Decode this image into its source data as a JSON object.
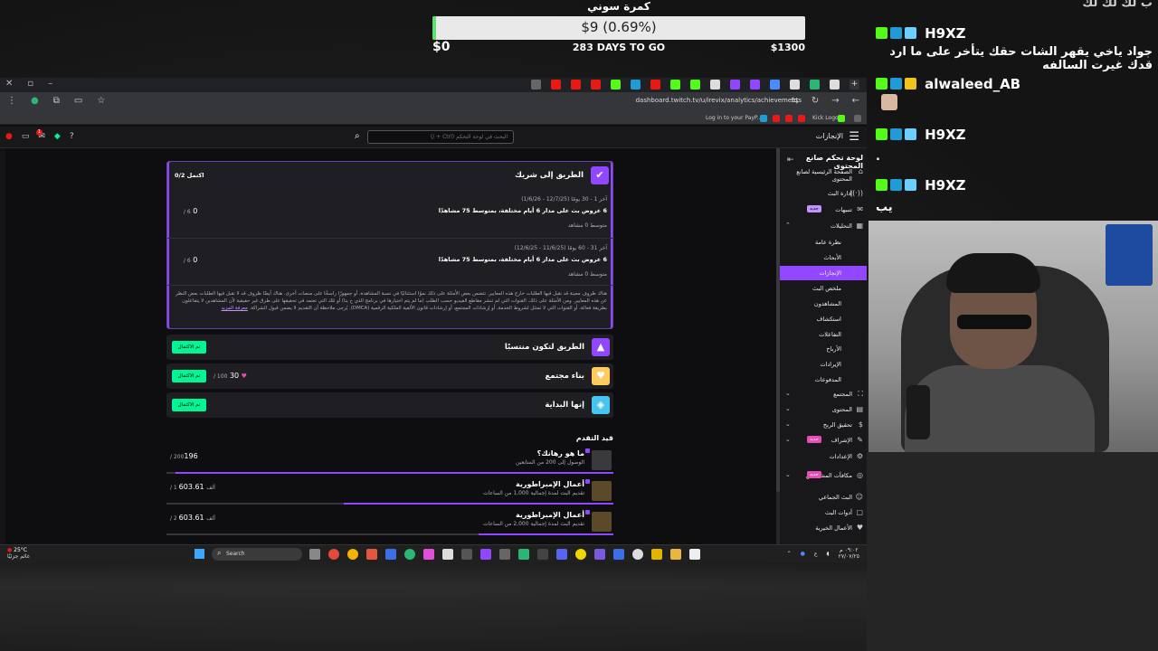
{
  "goal": {
    "title": "كمرة سوني",
    "progress_text": "$9 (0.69%)",
    "progress_fraction": 0.0069,
    "start": "$0",
    "days_left": "283 DAYS TO GO",
    "target": "$1300"
  },
  "chat": {
    "top_fragment": "ب لك لك لك",
    "messages": [
      {
        "user": "H9XZ",
        "text": "جواد ياخي يقهر الشات حقك يتأخر على ما ارد قدك غيرت السالفه"
      },
      {
        "user": "alwaleed_AB",
        "text": ""
      },
      {
        "user": "H9XZ",
        "text": "."
      },
      {
        "user": "H9XZ",
        "text": "يب"
      }
    ]
  },
  "browser": {
    "url": "dashboard.twitch.tv/u/irevix/analytics/achievements",
    "bookmark_paypal": "Log in to your PayP...",
    "bookmark_kick": "Kick Logo"
  },
  "topbar": {
    "page_name": "الإنجازات",
    "search_placeholder": "البحث في لوحة التحكم (Ctrl + /)",
    "notifications": "1"
  },
  "sidebar": {
    "header": "لوحة تحكم صانع المحتوى",
    "new_badge": "جديد",
    "items": [
      {
        "label": "الصفحة الرئيسية لصانع المحتوى"
      },
      {
        "label": "إدارة البث"
      },
      {
        "label": "تنبيهات"
      },
      {
        "label": "التحليلات"
      },
      {
        "label": "نظرة عامة"
      },
      {
        "label": "الأبحاث"
      },
      {
        "label": "الإنجازات"
      },
      {
        "label": "ملخص البث"
      },
      {
        "label": "المشاهدون"
      },
      {
        "label": "استكشاف"
      },
      {
        "label": "التفاعلات"
      },
      {
        "label": "الأرباح"
      },
      {
        "label": "الإيرادات"
      },
      {
        "label": "المدفوعات"
      },
      {
        "label": "المجتمع"
      },
      {
        "label": "المحتوى"
      },
      {
        "label": "تحقيق الربح"
      },
      {
        "label": "الإشراف"
      },
      {
        "label": "الإعدادات"
      },
      {
        "label": "مكافآت المشاهدين"
      },
      {
        "label": "البث الجماعي"
      },
      {
        "label": "أدوات البث"
      },
      {
        "label": "الأعمال الخيرية"
      }
    ]
  },
  "achievements": {
    "partner": {
      "title": "الطريق إلى شريك",
      "progress": "اكتمل 0/2",
      "tasks": [
        {
          "period": "آخر 1 - 30 يومًا (12/7/25 - 1/6/26)",
          "title": "6 عروض بث على مدار 6 أيام مختلفة، بمتوسط 75 مشاهدًا",
          "avg": "متوسط 0 مشاهد",
          "count": "0",
          "of": "/ 6"
        },
        {
          "period": "آخر 31 - 60 يومًا (11/6/25 - 12/6/25)",
          "title": "6 عروض بث على مدار 6 أيام مختلفة، بمتوسط 75 مشاهدًا",
          "avg": "متوسط 0 مشاهد",
          "count": "0",
          "of": "/ 6"
        }
      ],
      "notice": "هناك ظروف معينة قد نقبل فيها الطلبات خارج هذه المعايير. تتضمن بعض الأمثلة على ذلك نموًا استثنائيًا في نسبة المشاهدة، أو جمهورًا راسخًا على منصات أخرى. هناك أيضًا ظروف قد لا نقبل فيها الطلبات بعض النظر عن هذه المعايير. ومن الأمثلة على ذلك، القنوات التي لم تنشر مقاطع الفيديو حسب الطلب (ما لم يتم اختيارها في برنامج الذي ح ينا) أو تلك التي تعتمد في تحقيقها على طرق غير حقيقية لأن المشاهدين لا يتفاعلون بطريقة فعالة، أو القنوات التي لا تمتثل لشروط الخدمة، أو إرشادات المجتمع، أو إرشادات قانون الألفية الملكية الرقمية (DMCA). يُرجى ملاحظة أن التقديم لا يضمن قبول الشراكة.",
      "learn_more": "معرفة المزيد"
    },
    "affiliate": {
      "title": "الطريق لتكون منتسبًا",
      "status": "تم الاكتمال"
    },
    "community": {
      "title": "بناء مجتمع",
      "status": "تم الاكتمال",
      "value": "30",
      "of": "/ 100"
    },
    "beginning": {
      "title": "إنها البداية",
      "status": "تم الاكتمال"
    }
  },
  "in_progress": {
    "heading": "قيد التقدم",
    "items": [
      {
        "title": "ما هو رهانك؟",
        "subtitle": "الوصول إلى 200 من المتابعين",
        "value": "196",
        "of": "/ 200",
        "fraction": 0.98
      },
      {
        "title": "أعمال الإمبراطورية",
        "subtitle": "تقديم البث لمدة إجمالية 1,000 من الساعات",
        "value": "603.61",
        "of": "/ 1 ألف",
        "fraction": 0.6036
      },
      {
        "title": "أعمال الإمبراطورية",
        "subtitle": "تقديم البث لمدة إجمالية 2,000 من الساعات",
        "value": "603.61",
        "of": "/ 2 ألف",
        "fraction": 0.3018
      }
    ]
  },
  "taskbar": {
    "temperature": "25°C",
    "weather": "غائم جزئيًا",
    "search": "Search",
    "lang": "ع",
    "time": "٠٩:٠٢ م",
    "date": "٢٧/٠٧/٢٥"
  }
}
